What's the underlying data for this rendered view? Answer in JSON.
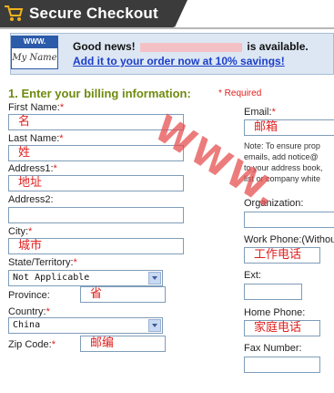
{
  "header": {
    "title": "Secure Checkout",
    "bg_color": "#3b3b3b",
    "icon": "shopping-cart-icon"
  },
  "banner": {
    "icon_top": "WWW.",
    "icon_bottom": "My Name",
    "good_news_prefix": "Good news!",
    "good_news_suffix": "is available.",
    "add_link": "Add it to your order now at 10% savings!"
  },
  "section": {
    "title": "1. Enter your billing information:",
    "required_note": "* Required"
  },
  "left_form": {
    "first_name": {
      "label": "First Name:",
      "required": "*",
      "value": "名"
    },
    "last_name": {
      "label": "Last Name:",
      "required": "*",
      "value": "姓"
    },
    "address1": {
      "label": "Address1:",
      "required": "*",
      "value": "地址"
    },
    "address2": {
      "label": "Address2:",
      "required": "",
      "value": ""
    },
    "city": {
      "label": "City:",
      "required": "*",
      "value": "城市"
    },
    "state": {
      "label": "State/Territory:",
      "required": "*",
      "value": "Not Applicable"
    },
    "province": {
      "label": "Province:",
      "required": "",
      "value": "省"
    },
    "country": {
      "label": "Country:",
      "required": "*",
      "value": "China"
    },
    "zip": {
      "label": "Zip Code:",
      "required": "*",
      "value": "邮编"
    }
  },
  "right_form": {
    "email": {
      "label": "Email:",
      "required": "*",
      "value": "邮箱"
    },
    "note_lines": [
      "Note: To ensure prop",
      "emails, add notice@",
      "to your address book,",
      "list or company white"
    ],
    "organization": {
      "label": "Organization:",
      "value": ""
    },
    "work_phone": {
      "label": "Work Phone:(Without",
      "value": "工作电话"
    },
    "ext": {
      "label": "Ext:",
      "value": ""
    },
    "home_phone": {
      "label": "Home Phone:",
      "value": "家庭电话"
    },
    "fax": {
      "label": "Fax Number:",
      "value": ""
    }
  },
  "watermark": "WWW.",
  "colors": {
    "accent_green": "#6f8a0f",
    "required_red": "#e0201f",
    "link_blue": "#1a3ec9",
    "banner_bg": "#dde7f3"
  }
}
